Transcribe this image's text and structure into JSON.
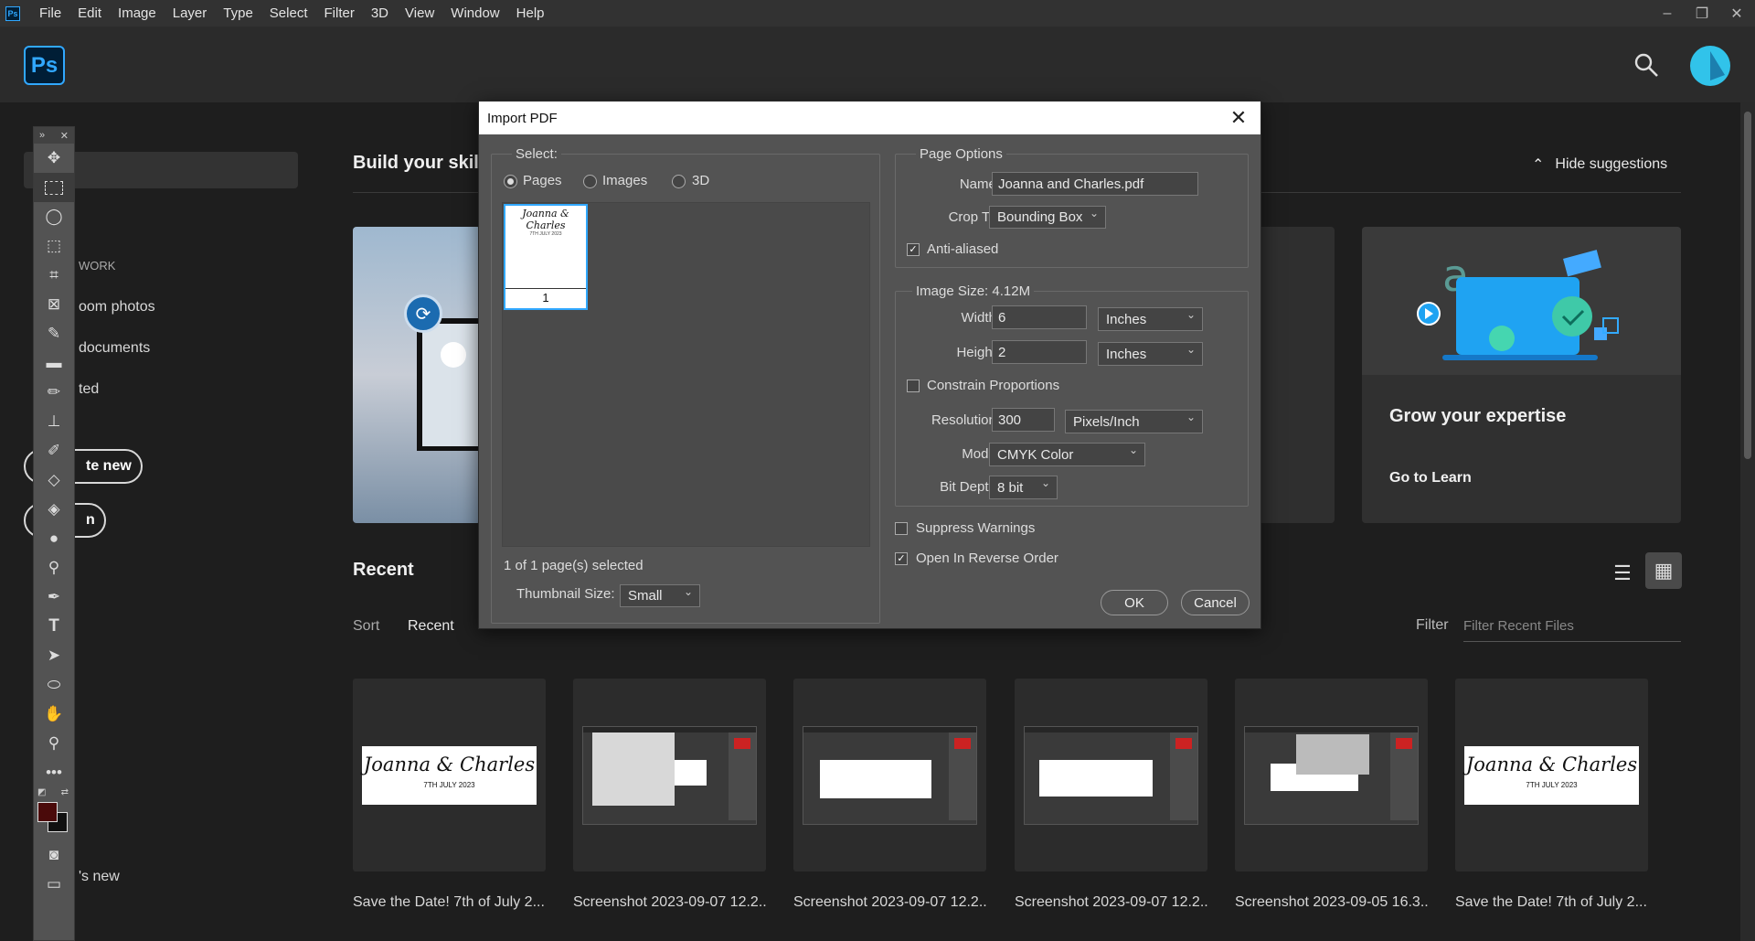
{
  "menubar": {
    "logo": "Ps",
    "items": [
      "File",
      "Edit",
      "Image",
      "Layer",
      "Type",
      "Select",
      "Filter",
      "3D",
      "View",
      "Window",
      "Help"
    ],
    "window_controls": {
      "minimize": "–",
      "restore": "❐",
      "close": "✕"
    }
  },
  "header": {
    "logo": "Ps"
  },
  "left_panel": {
    "section": "WORK",
    "items": [
      "oom photos",
      "documents",
      "ted"
    ],
    "create_new": "te new",
    "open": "n",
    "whats_new": "'s new"
  },
  "home": {
    "build_skills": "Build your skil",
    "hide_suggestions": "Hide suggestions",
    "grow_title": "Grow your expertise",
    "go_to_learn": "Go to Learn",
    "recent": "Recent",
    "sort_label": "Sort",
    "sort_value": "Recent",
    "filter_label": "Filter",
    "filter_placeholder": "Filter Recent Files",
    "recent_files": [
      {
        "name": "Save the Date! 7th of July 2...",
        "kind": "banner",
        "title": "Joanna & Charles",
        "date": "7TH JULY 2023"
      },
      {
        "name": "Screenshot 2023-09-07 12.2...",
        "kind": "shot"
      },
      {
        "name": "Screenshot 2023-09-07 12.2...",
        "kind": "shot"
      },
      {
        "name": "Screenshot 2023-09-07 12.2...",
        "kind": "shot"
      },
      {
        "name": "Screenshot 2023-09-05 16.3...",
        "kind": "shot"
      },
      {
        "name": "Save the Date! 7th of July 2...",
        "kind": "banner",
        "title": "Joanna & Charles",
        "date": "7TH JULY 2023"
      }
    ]
  },
  "dialog": {
    "title": "Import PDF",
    "select_group": "Select:",
    "radio_pages": "Pages",
    "radio_images": "Images",
    "radio_3d": "3D",
    "page_thumb_title": "Joanna & Charles",
    "page_thumb_sub": "7TH JULY 2023",
    "page_number": "1",
    "pages_selected": "1 of 1 page(s) selected",
    "thumbnail_size_label": "Thumbnail Size:",
    "thumbnail_size_value": "Small",
    "page_options": "Page Options",
    "name_label": "Name:",
    "name_value": "Joanna and Charles.pdf",
    "crop_to_label": "Crop To:",
    "crop_to_value": "Bounding Box",
    "anti_aliased": "Anti-aliased",
    "image_size": "Image Size: 4.12M",
    "width_label": "Width:",
    "width_value": "6",
    "width_unit": "Inches",
    "height_label": "Height:",
    "height_value": "2",
    "height_unit": "Inches",
    "constrain": "Constrain Proportions",
    "resolution_label": "Resolution:",
    "resolution_value": "300",
    "resolution_unit": "Pixels/Inch",
    "mode_label": "Mode:",
    "mode_value": "CMYK Color",
    "bit_depth_label": "Bit Depth:",
    "bit_depth_value": "8 bit",
    "suppress_warnings": "Suppress Warnings",
    "reverse_order": "Open In Reverse Order",
    "ok": "OK",
    "cancel": "Cancel",
    "checked_mark": "✓"
  }
}
